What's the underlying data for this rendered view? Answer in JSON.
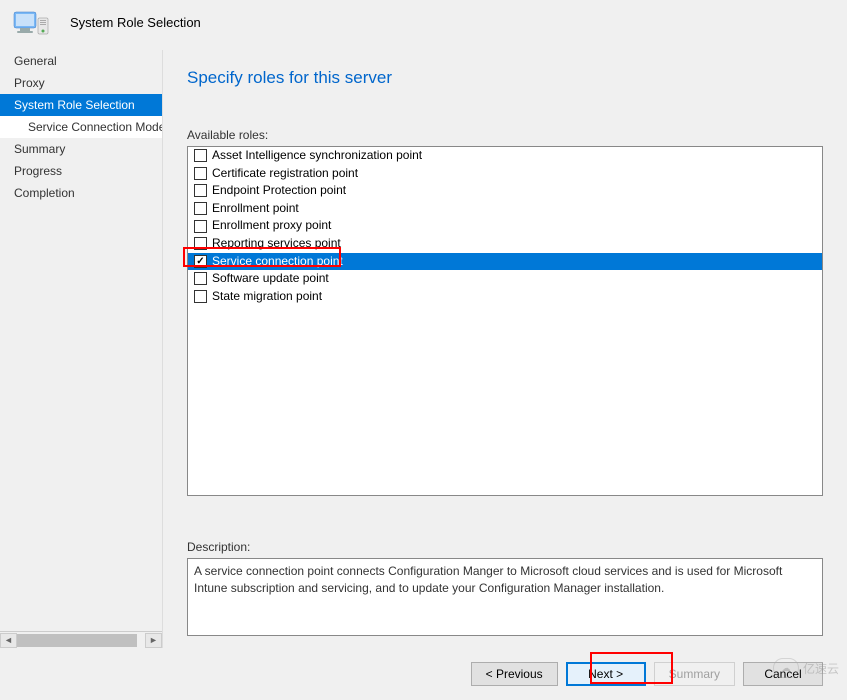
{
  "titleBar": {
    "title": "System Role Selection"
  },
  "sidebar": {
    "items": [
      {
        "label": "General",
        "selected": false,
        "sub": false
      },
      {
        "label": "Proxy",
        "selected": false,
        "sub": false
      },
      {
        "label": "System Role Selection",
        "selected": true,
        "sub": false
      },
      {
        "label": "Service Connection Mode",
        "selected": false,
        "sub": true
      },
      {
        "label": "Summary",
        "selected": false,
        "sub": false
      },
      {
        "label": "Progress",
        "selected": false,
        "sub": false
      },
      {
        "label": "Completion",
        "selected": false,
        "sub": false
      }
    ]
  },
  "main": {
    "heading": "Specify roles for this server",
    "rolesLabel": "Available roles:",
    "roles": [
      {
        "label": "Asset Intelligence synchronization point",
        "checked": false,
        "selected": false
      },
      {
        "label": "Certificate registration point",
        "checked": false,
        "selected": false
      },
      {
        "label": "Endpoint Protection point",
        "checked": false,
        "selected": false
      },
      {
        "label": "Enrollment point",
        "checked": false,
        "selected": false
      },
      {
        "label": "Enrollment proxy point",
        "checked": false,
        "selected": false
      },
      {
        "label": "Reporting services point",
        "checked": false,
        "selected": false
      },
      {
        "label": "Service connection point",
        "checked": true,
        "selected": true
      },
      {
        "label": "Software update point",
        "checked": false,
        "selected": false
      },
      {
        "label": "State migration point",
        "checked": false,
        "selected": false
      }
    ],
    "descriptionLabel": "Description:",
    "descriptionText": "A service connection point connects Configuration Manger to Microsoft cloud services and is used for Microsoft Intune subscription and servicing, and to update your Configuration Manager installation."
  },
  "buttons": {
    "previous": "< Previous",
    "next": "Next >",
    "summary": "Summary",
    "cancel": "Cancel"
  },
  "watermark": {
    "text": "亿速云"
  }
}
